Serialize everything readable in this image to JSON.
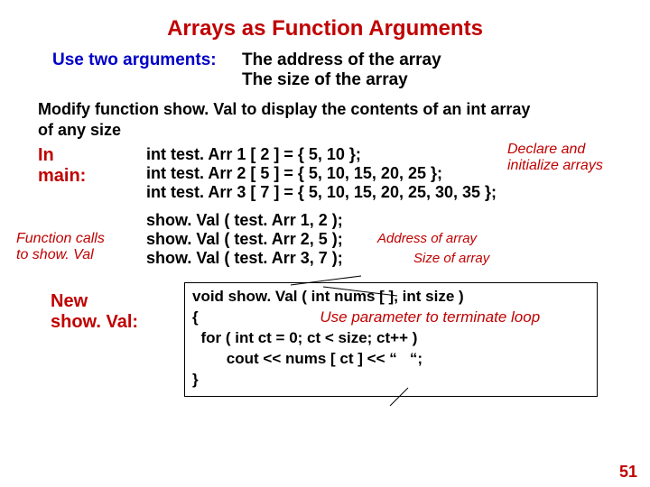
{
  "title": "Arrays as Function Arguments",
  "intro": {
    "label": "Use two arguments:",
    "arg1": "The address of the array",
    "arg2": "The size of the array"
  },
  "modify": "Modify function show. Val to display the contents of an int array of any size",
  "inMain": {
    "label1": "In",
    "label2": "main:",
    "decl_label1": "Declare and",
    "decl_label2": "initialize arrays",
    "line1": "int test. Arr 1 [ 2 ] = { 5, 10 };",
    "line2": "int test. Arr 2 [ 5 ] = { 5, 10, 15, 20, 25 };",
    "line3": "int test. Arr 3 [ 7 ] = { 5, 10, 15, 20, 25, 30, 35 };"
  },
  "calls": {
    "label1": "Function calls",
    "label2": "to show. Val",
    "line1": "show. Val ( test. Arr 1, 2 );",
    "line2": "show. Val ( test. Arr 2, 5 );",
    "line3": "show. Val ( test. Arr 3, 7 );",
    "ann_addr": "Address of array",
    "ann_size": "Size of array"
  },
  "newfunc": {
    "label1": "New",
    "label2": "show. Val:",
    "sig": "void show. Val ( int nums [ ], int size )",
    "open": "{",
    "ann": "Use parameter to terminate loop",
    "for": "  for ( int ct = 0; ct < size; ct++ )",
    "cout": "        cout << nums [ ct ] << “   “;",
    "close": "}"
  },
  "page": "51"
}
